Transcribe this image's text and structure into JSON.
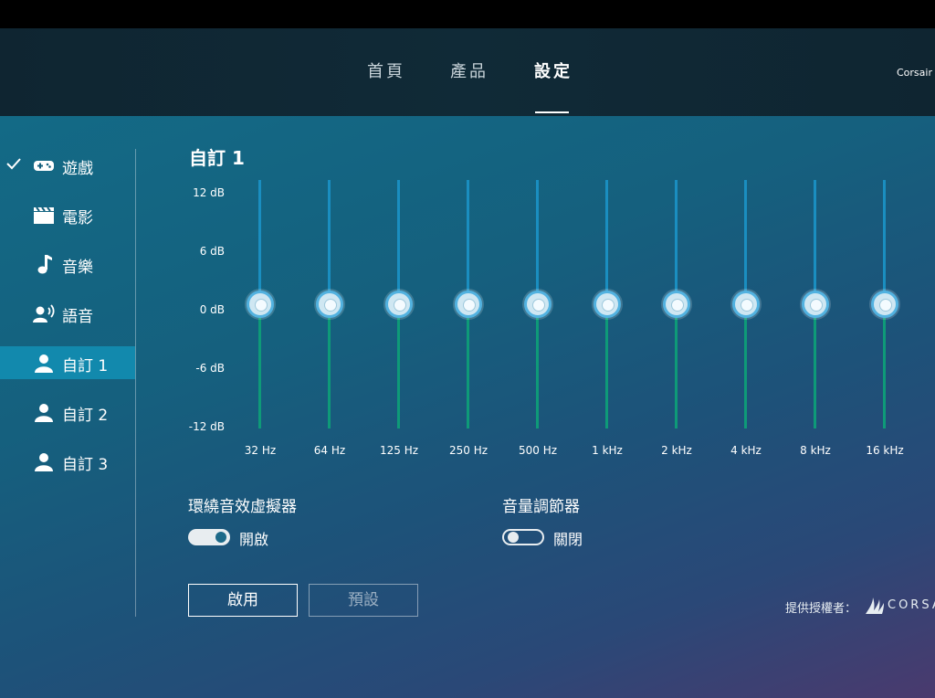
{
  "nav": {
    "tabs": [
      {
        "label": "首頁",
        "active": false
      },
      {
        "label": "產品",
        "active": false
      },
      {
        "label": "設定",
        "active": true
      }
    ],
    "device_name": "Corsair H"
  },
  "sidebar": {
    "items": [
      {
        "label": "遊戲",
        "icon": "gamepad-icon",
        "checked": true,
        "selected": false
      },
      {
        "label": "電影",
        "icon": "clapperboard-icon",
        "checked": false,
        "selected": false
      },
      {
        "label": "音樂",
        "icon": "music-note-icon",
        "checked": false,
        "selected": false
      },
      {
        "label": "語音",
        "icon": "voice-icon",
        "checked": false,
        "selected": false
      },
      {
        "label": "自訂 1",
        "icon": "user-icon",
        "checked": false,
        "selected": true
      },
      {
        "label": "自訂 2",
        "icon": "user-icon",
        "checked": false,
        "selected": false
      },
      {
        "label": "自訂 3",
        "icon": "user-icon",
        "checked": false,
        "selected": false
      }
    ]
  },
  "equalizer": {
    "title": "自訂 1",
    "db_labels": [
      "12 dB",
      "6 dB",
      "0 dB",
      "-6 dB",
      "-12 dB"
    ],
    "db_range": [
      -12,
      12
    ],
    "bands": [
      {
        "freq": "32 Hz",
        "gain": 0
      },
      {
        "freq": "64 Hz",
        "gain": 0
      },
      {
        "freq": "125 Hz",
        "gain": 0
      },
      {
        "freq": "250 Hz",
        "gain": 0
      },
      {
        "freq": "500 Hz",
        "gain": 0
      },
      {
        "freq": "1 kHz",
        "gain": 0
      },
      {
        "freq": "2 kHz",
        "gain": 0
      },
      {
        "freq": "4 kHz",
        "gain": 0
      },
      {
        "freq": "8 kHz",
        "gain": 0
      },
      {
        "freq": "16 kHz",
        "gain": 0
      }
    ]
  },
  "surround": {
    "label": "環繞音效虛擬器",
    "state_label": "開啟",
    "on": true
  },
  "volume_leveler": {
    "label": "音量調節器",
    "state_label": "關閉",
    "on": false
  },
  "buttons": {
    "apply": "啟用",
    "default": "預設"
  },
  "footer": {
    "powered_by": "提供授權者：",
    "brand": "CORSAIR"
  },
  "colors": {
    "accent": "#1289ad",
    "slider_track_top": "#1a8ec0",
    "slider_track_bottom": "#0e9a78",
    "knob_ring": "#52b2e0"
  }
}
